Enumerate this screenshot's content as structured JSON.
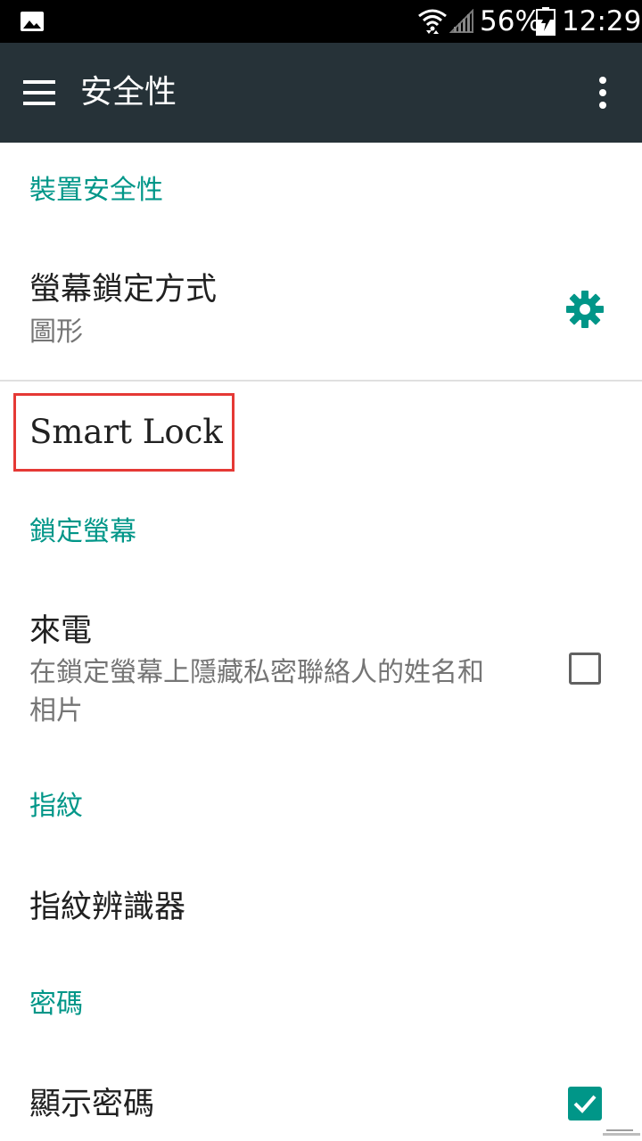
{
  "status_bar": {
    "battery_percent": "56%",
    "time": "12:29",
    "icons": [
      "image-notification-icon",
      "wifi-icon",
      "cell-signal-icon",
      "battery-charging-icon"
    ]
  },
  "app_bar": {
    "title": "安全性",
    "menu_icon": "hamburger-menu-icon",
    "more_icon": "more-vert-icon"
  },
  "sections": {
    "device_security": {
      "header": "裝置安全性",
      "screen_lock": {
        "title": "螢幕鎖定方式",
        "subtitle": "圖形"
      }
    },
    "smart_lock": {
      "title": "Smart Lock"
    },
    "lock_screen": {
      "header": "鎖定螢幕",
      "incoming_call": {
        "title": "來電",
        "subtitle_line1": "在鎖定螢幕上隱藏私密聯絡人的姓名和",
        "subtitle_line2": "相片",
        "checked": false
      }
    },
    "fingerprint": {
      "header": "指紋",
      "scanner": {
        "title": "指紋辨識器"
      }
    },
    "password": {
      "header": "密碼",
      "show_password": {
        "title": "顯示密碼",
        "checked": true
      }
    }
  },
  "colors": {
    "accent": "#009688",
    "app_bar": "#263238",
    "status_bar": "#000000",
    "highlight": "#e53935"
  }
}
